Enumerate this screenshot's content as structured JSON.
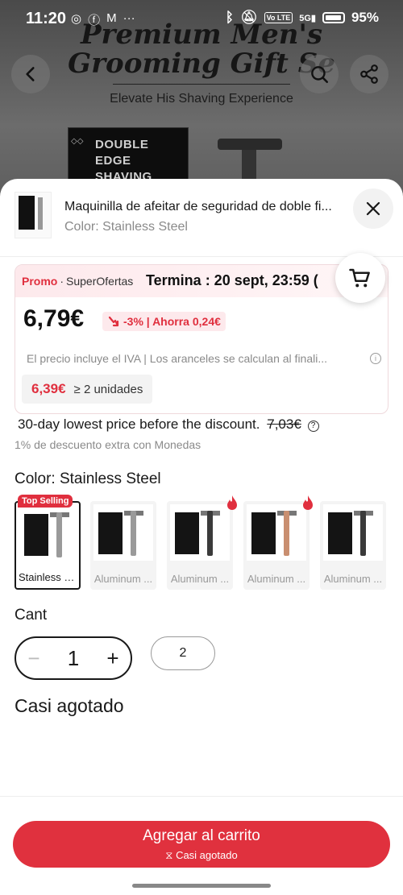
{
  "status_bar": {
    "time": "11:20",
    "app_icons": [
      "whatsapp-icon",
      "facebook-icon",
      "gmail-icon",
      "more-icon"
    ],
    "battery": "95%",
    "volte": "Vo LTE",
    "network": "5G"
  },
  "background": {
    "title_line1": "Premium Men's",
    "title_line2": "Grooming Gift Se",
    "subtitle": "Elevate His Shaving Experience",
    "box_text": "DOUBLE EDGE SHAVING RAZOR"
  },
  "sheet": {
    "product_title": "Maquinilla de afeitar de seguridad de doble fi...",
    "product_variant": "Color: Stainless Steel",
    "promo": {
      "brand": "Promo",
      "name": "SuperOfertas",
      "ends": "Termina :  20 sept, 23:59 ("
    },
    "price": "6,79€",
    "discount": "-3% | Ahorra 0,24€",
    "tax_note": "El precio incluye el IVA | Los aranceles se calculan al finali...",
    "tier_price": "6,39€",
    "tier_qty": "≥ 2 unidades",
    "lowest_text": "30-day lowest price before the discount.",
    "lowest_price": "7,03€",
    "coins_text": "1% de descuento extra con Monedas",
    "color_label": "Color: Stainless Steel",
    "top_selling": "Top Selling",
    "variants": [
      {
        "label": "Stainless S..."
      },
      {
        "label": "Aluminum ..."
      },
      {
        "label": "Aluminum ..."
      },
      {
        "label": "Aluminum ..."
      },
      {
        "label": "Aluminum ..."
      }
    ],
    "qty_label": "Cant",
    "qty_value": "1",
    "qty_chip": "2",
    "stock_text": "Casi agotado",
    "add_button": "Agregar al carrito",
    "add_button_sub": "Casi agotado"
  },
  "colors": {
    "accent": "#e0313e",
    "promo_red": "#e02f3e"
  }
}
